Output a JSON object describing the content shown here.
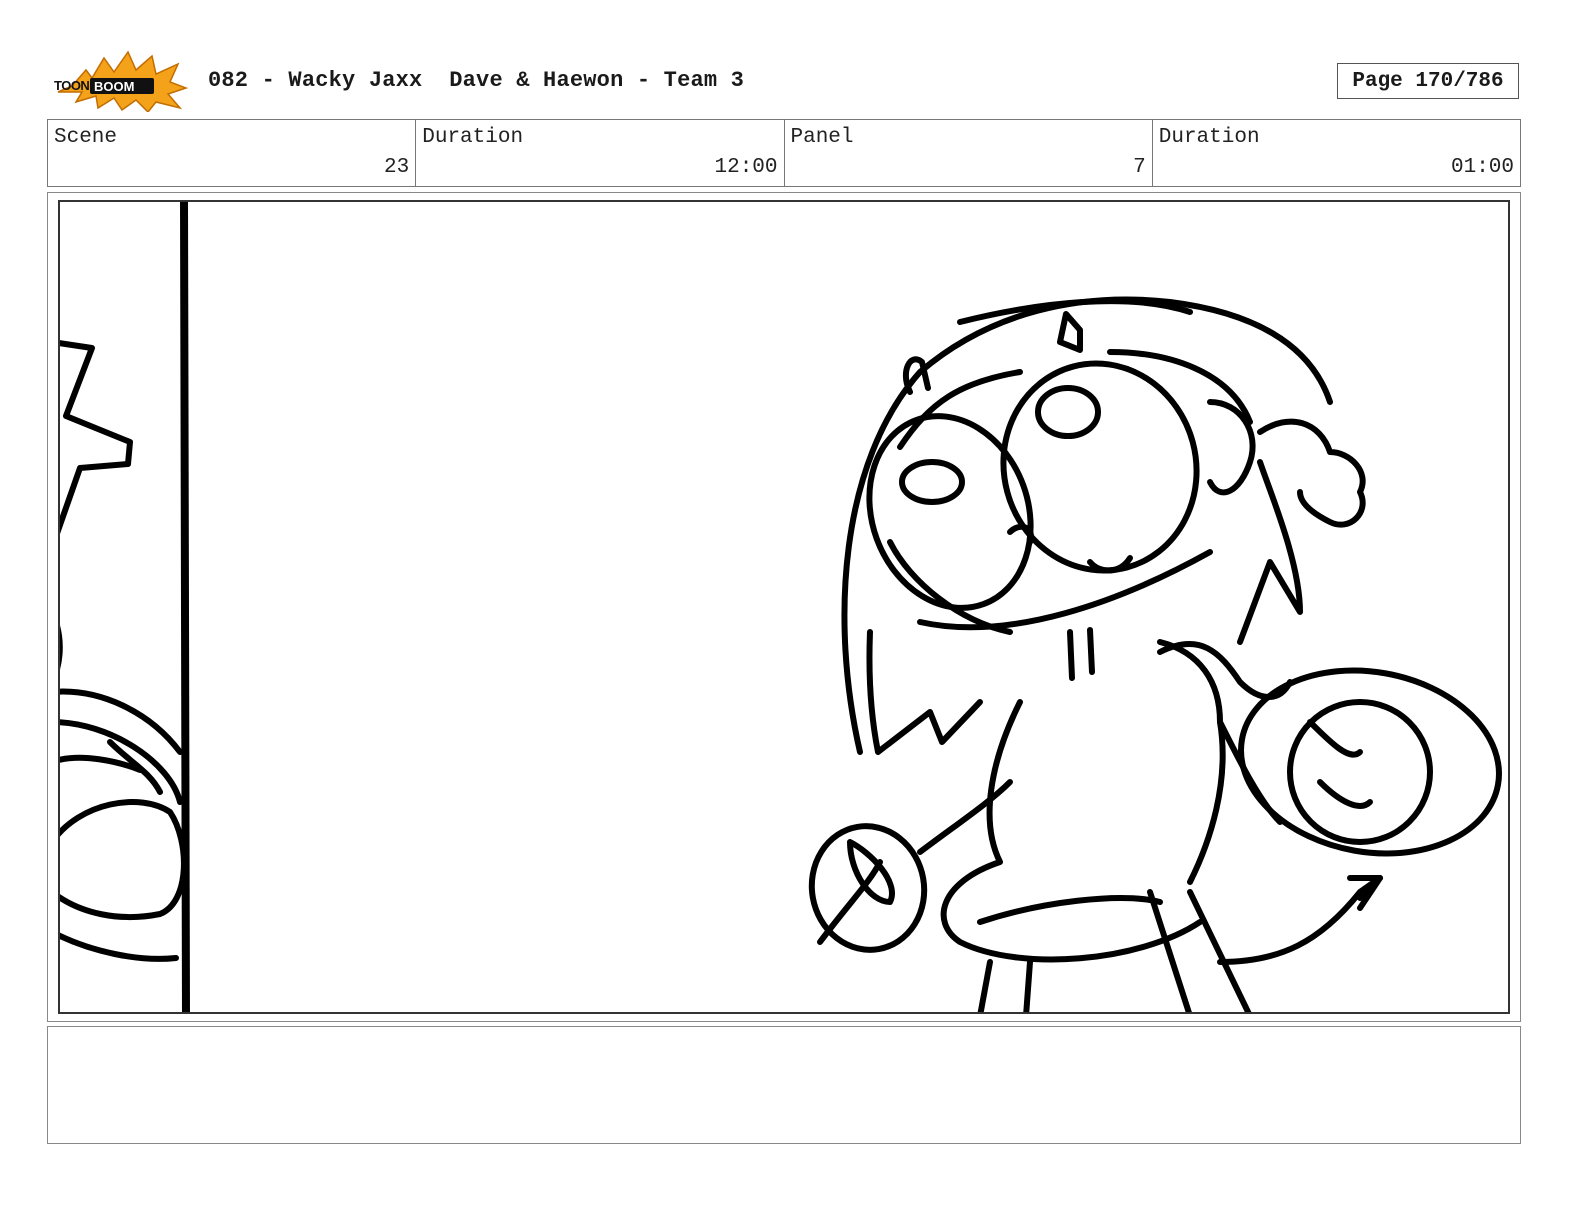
{
  "header": {
    "logo_text": "TOONBOOM",
    "title": "082 - Wacky Jaxx  Dave & Haewon - Team 3",
    "page": "Page 170/786"
  },
  "info": {
    "scene_label": "Scene",
    "scene_value": "23",
    "scene_duration_label": "Duration",
    "scene_duration_value": "12:00",
    "panel_label": "Panel",
    "panel_value": "7",
    "panel_duration_label": "Duration",
    "panel_duration_value": "01:00"
  },
  "panel": {
    "sketch": "storyboard-drawing"
  },
  "notes": {
    "text": ""
  },
  "colors": {
    "logo_burst": "#f5a21b",
    "ink": "#000000",
    "border": "#888888"
  }
}
